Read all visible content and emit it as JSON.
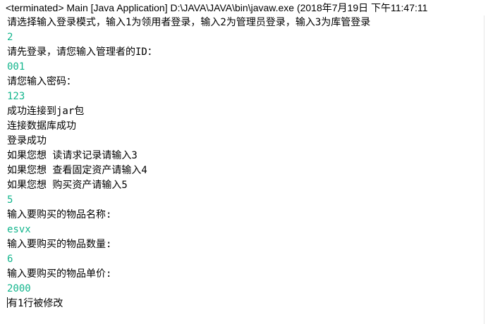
{
  "header": {
    "status_line": "<terminated> Main [Java Application] D:\\JAVA\\JAVA\\bin\\javaw.exe (2018年7月19日 下午11:47:11"
  },
  "colors": {
    "input_text": "#12b58c",
    "output_text": "#000000",
    "background": "#ffffff"
  },
  "console": {
    "lines": [
      {
        "type": "output",
        "text": "请选择输入登录模式，输入1为领用者登录，输入2为管理员登录，输入3为库管登录"
      },
      {
        "type": "input",
        "text": "2"
      },
      {
        "type": "output",
        "text": "请先登录，请您输入管理者的ID："
      },
      {
        "type": "input",
        "text": "001"
      },
      {
        "type": "output",
        "text": "请您输入密码："
      },
      {
        "type": "input",
        "text": "123"
      },
      {
        "type": "output",
        "text": "成功连接到jar包"
      },
      {
        "type": "output",
        "text": "连接数据库成功"
      },
      {
        "type": "output",
        "text": "登录成功"
      },
      {
        "type": "output",
        "text": "如果您想 读请求记录请输入3"
      },
      {
        "type": "output",
        "text": "如果您想 查看固定资产请输入4"
      },
      {
        "type": "output",
        "text": "如果您想 购买资产请输入5"
      },
      {
        "type": "input",
        "text": "5"
      },
      {
        "type": "output",
        "text": "输入要购买的物品名称:"
      },
      {
        "type": "input",
        "text": "esvx"
      },
      {
        "type": "output",
        "text": "输入要购买的物品数量:"
      },
      {
        "type": "input",
        "text": "6"
      },
      {
        "type": "output",
        "text": "输入要购买的物品单价:"
      },
      {
        "type": "input",
        "text": "2000"
      },
      {
        "type": "output",
        "text": "有1行被修改"
      }
    ]
  }
}
